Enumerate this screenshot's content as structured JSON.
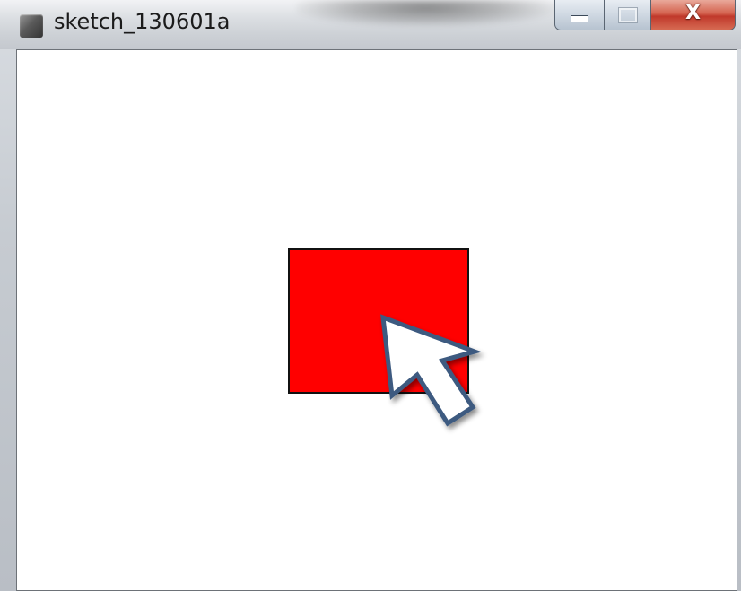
{
  "window": {
    "title": "sketch_130601a",
    "buttons": {
      "minimize": "minimize",
      "maximize": "maximize",
      "close_glyph": "X"
    }
  },
  "canvas": {
    "background": "#ffffff",
    "shape": {
      "type": "rectangle",
      "fill": "#ff0000",
      "stroke": "#111111"
    }
  },
  "cursor": {
    "icon": "arrow-pointer-icon",
    "fill": "#ffffff",
    "stroke": "#3d5a80"
  },
  "colors": {
    "close_button": "#c0392b",
    "titlebar": "#dcdfe3"
  }
}
